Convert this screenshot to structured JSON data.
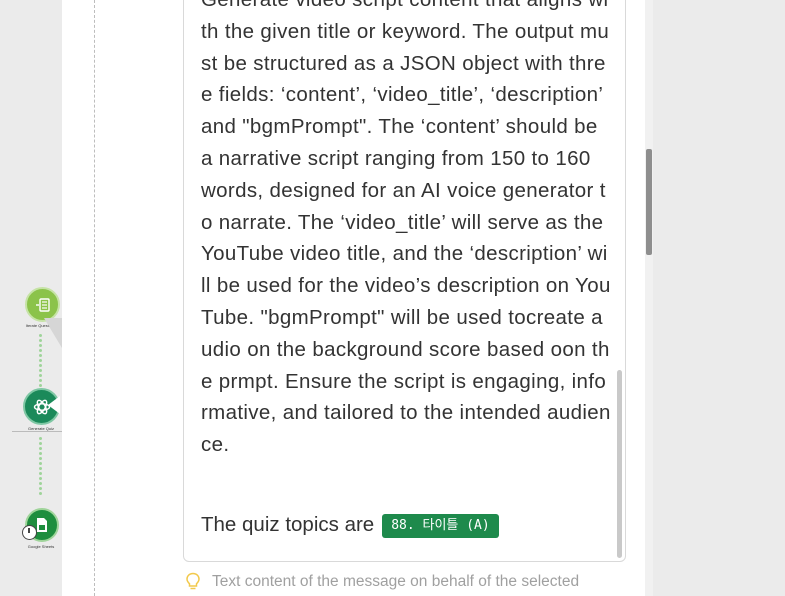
{
  "workflow": {
    "nodes": [
      {
        "label": "Iterate Questions",
        "icon": "list-icon",
        "color": "#8bc34a"
      },
      {
        "label": "Generate Quiz",
        "icon": "openai-icon",
        "color": "#1b8a5a"
      },
      {
        "label": "Google Sheets",
        "icon": "sheets-icon",
        "color": "#1e8e3e"
      }
    ]
  },
  "message": {
    "text": "Generate video script content that aligns with the given title or keyword. The output must be structured as a JSON object with three fields: ‘content’, ‘video_title’, ‘description’ and \"bgmPrompt\". The ‘content’ should be a narrative script ranging from 150 to 160 words, designed for an AI voice generator to narrate. The ‘video_title’ will serve as the YouTube video title, and the ‘description’ will be used for the video’s description on YouTube. \"bgmPrompt\" will be used tocreate audio on the background score based oon the prmpt. Ensure the script is engaging, informative, and tailored to the intended audience.",
    "quiz_prefix": "The quiz topics are",
    "variable_tag": "88. 타이틀 (A)"
  },
  "hint": {
    "icon": "lightbulb-icon",
    "text": "Text content of the message on behalf of the selected"
  },
  "colors": {
    "variable_tag_bg": "#1e8a4c",
    "connector": "#9fd49a"
  }
}
